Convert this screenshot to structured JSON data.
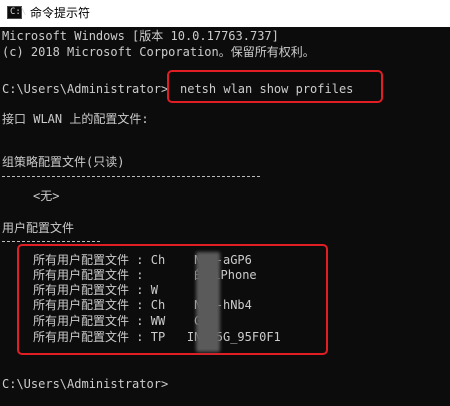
{
  "window": {
    "title": "命令提示符",
    "icon": "cmd-icon",
    "icon_glyph": "C:\\"
  },
  "console": {
    "header_1": "Microsoft Windows [版本 10.0.17763.737]",
    "header_2": "(c) 2018 Microsoft Corporation。保留所有权利。",
    "prompt_1": "C:\\Users\\Administrator>",
    "command": "netsh wlan show profiles",
    "interface_line": "接口 WLAN 上的配置文件:",
    "group_policy_title": "组策略配置文件(只读)",
    "group_policy_none": "<无>",
    "user_profiles_title": "用户配置文件",
    "profiles": [
      {
        "label": "所有用户配置文件",
        "sep": ":",
        "value": "Ch    Net-aGP6"
      },
      {
        "label": "所有用户配置文件",
        "sep": ":",
        "value": "      的 iPhone"
      },
      {
        "label": "所有用户配置文件",
        "sep": ":",
        "value": "W"
      },
      {
        "label": "所有用户配置文件",
        "sep": ":",
        "value": "Ch    Net-hNb4"
      },
      {
        "label": "所有用户配置文件",
        "sep": ":",
        "value": "WW    G"
      },
      {
        "label": "所有用户配置文件",
        "sep": ":",
        "value": "TP   INK_5G_95F0F1"
      }
    ],
    "prompt_2": "C:\\Users\\Administrator>"
  },
  "colors": {
    "background": "#0c0c0c",
    "text": "#cccccc",
    "highlight_border": "#e01e24",
    "titlebar": "#ffffff"
  }
}
